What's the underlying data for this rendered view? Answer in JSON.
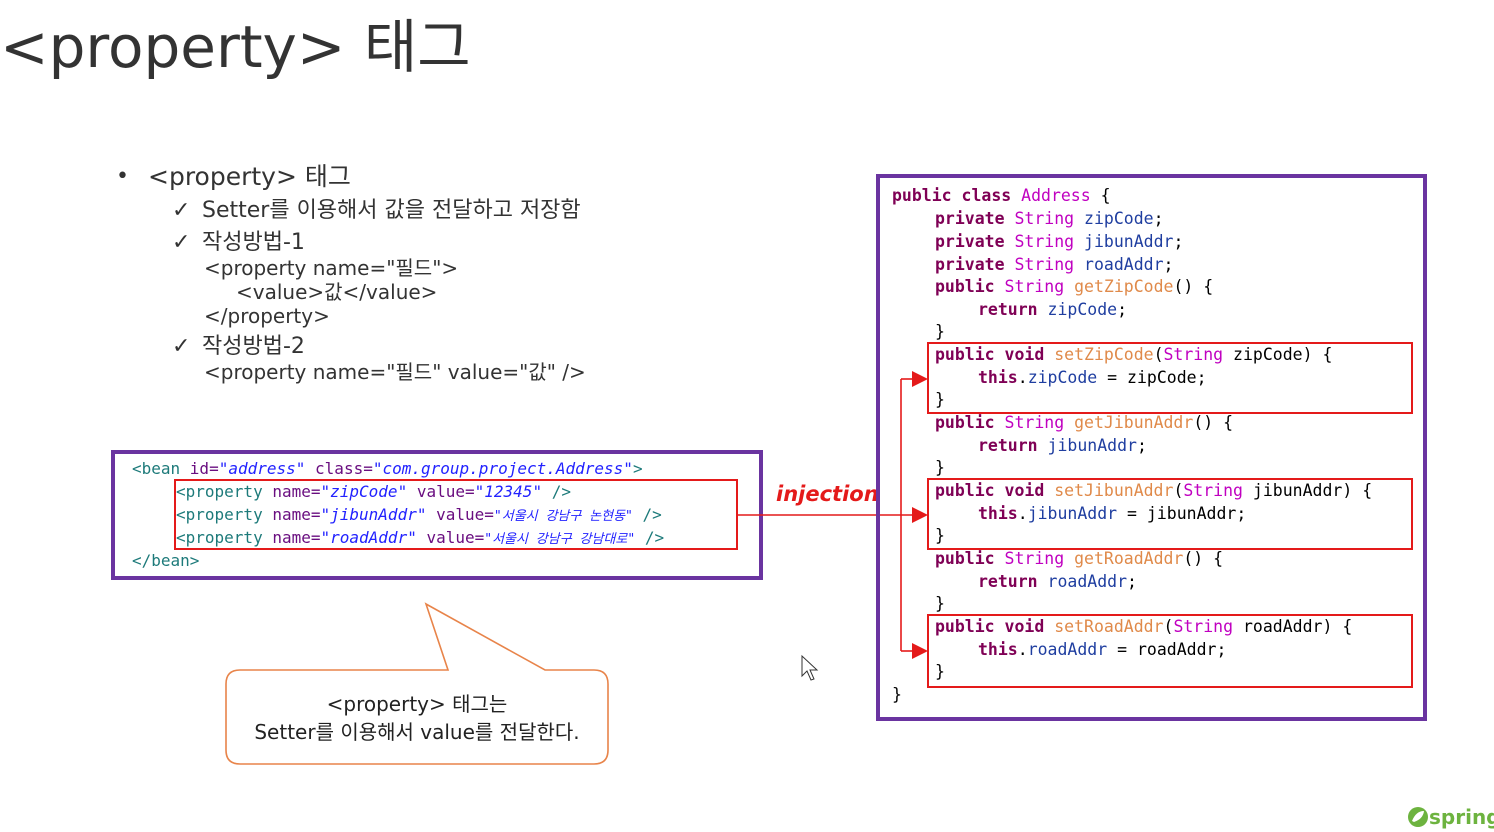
{
  "title": "<property> 태그",
  "bullets": {
    "main": "<property> 태그",
    "check_mark": "✓",
    "bullet_mark": "•",
    "item1": "Setter를 이용해서 값을 전달하고 저장함",
    "item2": "작성방법-1",
    "item2_line1": "<property name=\"필드\">",
    "item2_line2": "<value>값</value>",
    "item2_line3": "</property>",
    "item3": "작성방법-2",
    "item3_line1": "<property name=\"필드\" value=\"값\" />"
  },
  "xml": {
    "bean_open_tag": "<bean ",
    "bean_id_attr": "id=",
    "bean_id_val": "\"address\"",
    "bean_class_attr": " class=",
    "bean_class_val": "\"com.group.project.Address\"",
    "bean_open_end": ">",
    "properties": [
      {
        "tag": "<property ",
        "name_attr": "name=",
        "name_val": "\"zipCode\"",
        "value_attr": " value=",
        "value_val": "\"12345\"",
        "end": " />"
      },
      {
        "tag": "<property ",
        "name_attr": "name=",
        "name_val": "\"jibunAddr\"",
        "value_attr": " value=",
        "value_val": "\"서울시 강남구 논현동\"",
        "end": " />"
      },
      {
        "tag": "<property ",
        "name_attr": "name=",
        "name_val": "\"roadAddr\"",
        "value_attr": " value=",
        "value_val": "\"서울시 강남구 강남대로\"",
        "end": " />"
      }
    ],
    "bean_close": "</bean>"
  },
  "injection_label": "injection",
  "callout": {
    "line1": "<property> 태그는",
    "line2": "Setter를 이용해서 value를 전달한다."
  },
  "java": {
    "l1": [
      "public class ",
      "Address",
      " {"
    ],
    "fields": [
      [
        "private ",
        "String ",
        "zipCode",
        ";"
      ],
      [
        "private ",
        "String ",
        "jibunAddr",
        ";"
      ],
      [
        "private ",
        "String ",
        "roadAddr",
        ";"
      ]
    ],
    "getZip": [
      "public ",
      "String ",
      "getZipCode",
      "() {"
    ],
    "retZip": [
      "return ",
      "zipCode",
      ";"
    ],
    "setZip": [
      "public void ",
      "setZipCode",
      "(",
      "String ",
      "zipCode) {"
    ],
    "bodyZip": [
      "this",
      ".",
      "zipCode",
      " = ",
      "zipCode",
      ";"
    ],
    "getJibun": [
      "public ",
      "String ",
      "getJibunAddr",
      "() {"
    ],
    "retJibun": [
      "return ",
      "jibunAddr",
      ";"
    ],
    "setJibun": [
      "public void ",
      "setJibunAddr",
      "(",
      "String ",
      "jibunAddr) {"
    ],
    "bodyJibun": [
      "this",
      ".",
      "jibunAddr",
      " = ",
      "jibunAddr",
      ";"
    ],
    "getRoad": [
      "public ",
      "String ",
      "getRoadAddr",
      "() {"
    ],
    "retRoad": [
      "return ",
      "roadAddr",
      ";"
    ],
    "setRoad": [
      "public void ",
      "setRoadAddr",
      "(",
      "String ",
      "roadAddr) {"
    ],
    "bodyRoad": [
      "this",
      ".",
      "roadAddr",
      " = ",
      "roadAddr",
      ";"
    ],
    "close_brace": "}"
  },
  "logo": {
    "text": "spring"
  },
  "colors": {
    "frame": "#6a34a0",
    "highlight": "#e41a1a",
    "callout_border": "#e8844a",
    "spring": "#6db33f"
  }
}
